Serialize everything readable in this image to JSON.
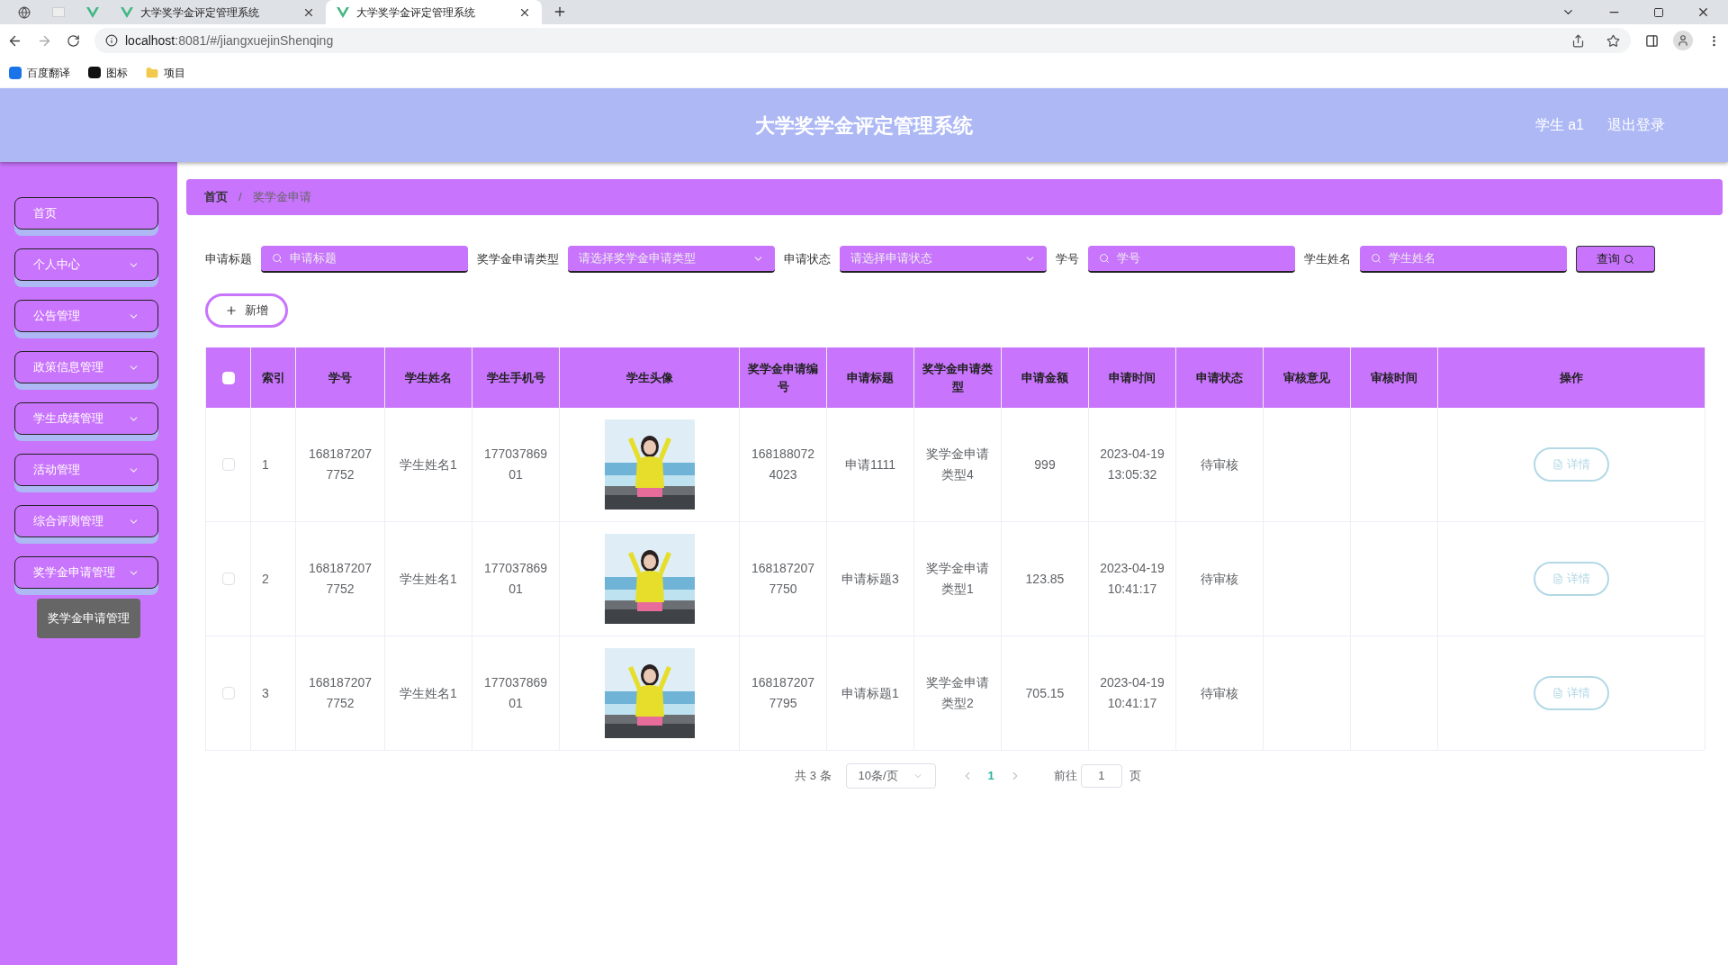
{
  "browser": {
    "tabs": [
      {
        "kind": "icon",
        "selected": false
      },
      {
        "kind": "icon",
        "selected": false
      },
      {
        "kind": "icon",
        "selected": false
      },
      {
        "kind": "page",
        "title": "大学奖学金评定管理系统",
        "selected": false
      },
      {
        "kind": "page",
        "title": "大学奖学金评定管理系统",
        "selected": true
      }
    ],
    "url_host": "localhost",
    "url_rest": ":8081/#/jiangxuejinShenqing",
    "bookmarks": [
      "百度翻译",
      "图标",
      "项目"
    ]
  },
  "header": {
    "title": "大学奖学金评定管理系统",
    "user": "学生 a1",
    "logout": "退出登录"
  },
  "sidebar": {
    "items": [
      {
        "label": "首页",
        "expandable": false
      },
      {
        "label": "个人中心",
        "expandable": true
      },
      {
        "label": "公告管理",
        "expandable": true
      },
      {
        "label": "政策信息管理",
        "expandable": true
      },
      {
        "label": "学生成绩管理",
        "expandable": true
      },
      {
        "label": "活动管理",
        "expandable": true
      },
      {
        "label": "综合评测管理",
        "expandable": true
      },
      {
        "label": "奖学金申请管理",
        "expandable": true
      }
    ],
    "tooltip": "奖学金申请管理"
  },
  "breadcrumb": [
    "首页",
    "奖学金申请"
  ],
  "breadcrumb_separator": "/",
  "filters": [
    {
      "kind": "input",
      "label": "申请标题",
      "placeholder": "申请标题"
    },
    {
      "kind": "select",
      "label": "奖学金申请类型",
      "placeholder": "请选择奖学金申请类型"
    },
    {
      "kind": "select",
      "label": "申请状态",
      "placeholder": "请选择申请状态"
    },
    {
      "kind": "input",
      "label": "学号",
      "placeholder": "学号"
    },
    {
      "kind": "input",
      "label": "学生姓名",
      "placeholder": "学生姓名"
    }
  ],
  "search_button": "查询",
  "add_button": "新增",
  "table": {
    "header_checked": false,
    "columns": [
      "索引",
      "学号",
      "学生姓名",
      "学生手机号",
      "学生头像",
      "奖学金申请编号",
      "申请标题",
      "奖学金申请类型",
      "申请金额",
      "申请时间",
      "申请状态",
      "审核意见",
      "审核时间",
      "操作"
    ],
    "rows": [
      {
        "checked": false,
        "index": "1",
        "student_id": "1681872077752",
        "name": "学生姓名1",
        "phone": "17703786901",
        "number": "1681880724023",
        "title": "申请1111",
        "type": "奖学金申请类型4",
        "amount": "999",
        "time": "2023-04-19 13:05:32",
        "status": "待审核",
        "action": "详情"
      },
      {
        "checked": false,
        "index": "2",
        "student_id": "1681872077752",
        "name": "学生姓名1",
        "phone": "17703786901",
        "number": "1681872077750",
        "title": "申请标题3",
        "type": "奖学金申请类型1",
        "amount": "123.85",
        "time": "2023-04-19 10:41:17",
        "status": "待审核",
        "action": "详情"
      },
      {
        "checked": false,
        "index": "3",
        "student_id": "1681872077752",
        "name": "学生姓名1",
        "phone": "17703786901",
        "number": "1681872077795",
        "title": "申请标题1",
        "type": "奖学金申请类型2",
        "amount": "705.15",
        "time": "2023-04-19 10:41:17",
        "status": "待审核",
        "action": "详情"
      }
    ]
  },
  "pagination": {
    "total": "共 3 条",
    "page_size": "10条/页",
    "pages": [
      {
        "label": "1",
        "selected": true
      }
    ],
    "goto_label": "前往",
    "goto_value": "1",
    "goto_suffix": "页"
  }
}
